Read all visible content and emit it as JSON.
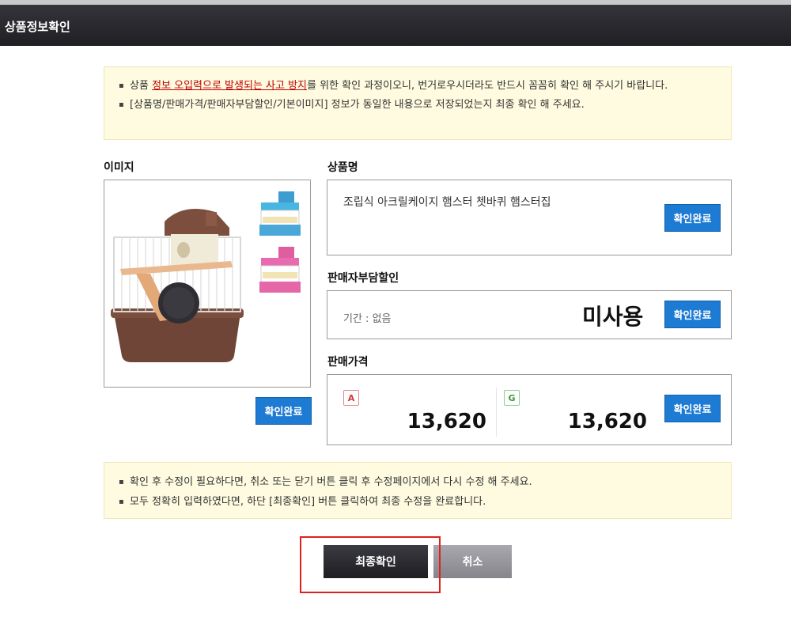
{
  "header": {
    "title": "상품정보확인"
  },
  "notice_top": {
    "line1_prefix": "상품 ",
    "line1_highlight": "정보 오입력으로 발생되는 사고 방지",
    "line1_suffix": "를 위한 확인 과정이오니, 번거로우시더라도 반드시 꼼꼼히 확인 해 주시기 바랍니다.",
    "line2": "[상품명/판매가격/판매자부담할인/기본이미지] 정보가 동일한 내용으로 저장되었는지 최종 확인 해 주세요."
  },
  "image_section": {
    "label": "이미지",
    "confirm_label": "확인완료"
  },
  "name_section": {
    "label": "상품명",
    "value": "조립식 아크릴케이지 햄스터 쳇바퀴 햄스터집",
    "confirm_label": "확인완료"
  },
  "discount_section": {
    "label": "판매자부담할인",
    "period": "기간 : 없음",
    "status": "미사용",
    "confirm_label": "확인완료"
  },
  "price_section": {
    "label": "판매가격",
    "badge_a": "A",
    "price_a": "13,620",
    "badge_g": "G",
    "price_g": "13,620",
    "confirm_label": "확인완료"
  },
  "notice_bottom": {
    "line1": "확인 후 수정이 필요하다면, 취소 또는 닫기 버튼 클릭 후 수정페이지에서 다시 수정 해 주세요.",
    "line2": "모두 정확히 입력하였다면, 하단 [최종확인] 버튼 클릭하여 최종 수정을 완료합니다."
  },
  "actions": {
    "final_label": "최종확인",
    "cancel_label": "취소"
  },
  "colors": {
    "confirm_blue": "#1e7bd3",
    "highlight_red": "#c00000",
    "notice_bg": "#fefbe0",
    "outline_red": "#e0201c"
  }
}
